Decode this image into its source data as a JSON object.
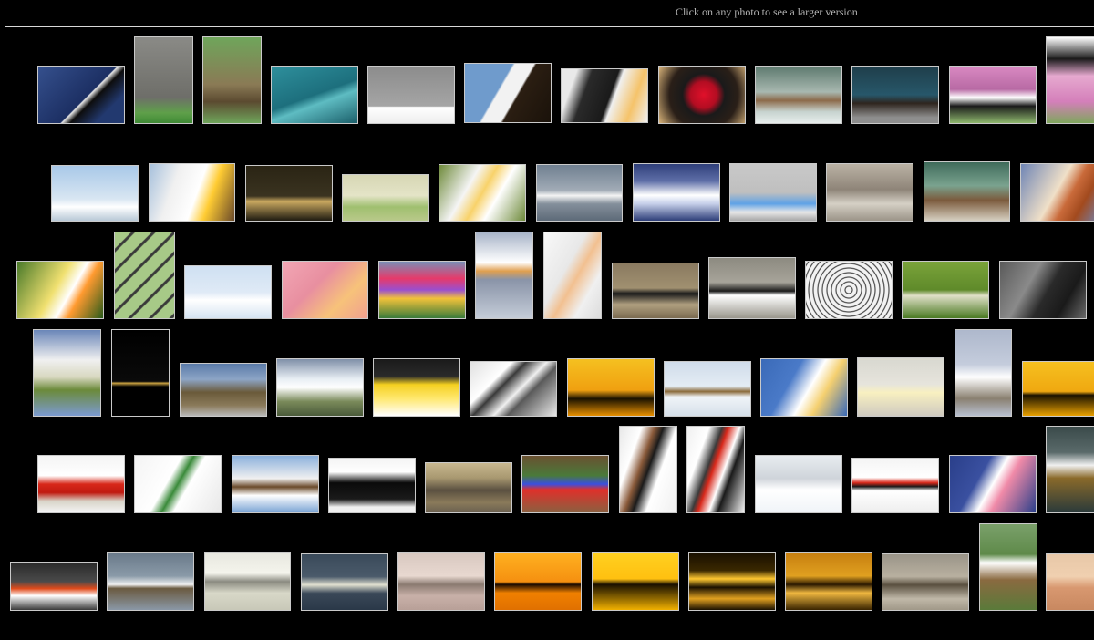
{
  "header": {
    "instruction": "Click on any photo to see a larger version"
  },
  "colors": {
    "background": "#000000",
    "text": "#b4b4b4",
    "rule": "#d8d8d8",
    "thumb_border": "#c9c9c9"
  },
  "gallery": {
    "rows": [
      [
        {
          "name": "blue-sea-bird-photo",
          "bg": "linear-gradient(135deg,#35508d 0%,#1c2f63 55%,#e8e8e8 56%,#0d0d0d 62%,#22396f 80%)"
        },
        {
          "name": "elephants-photo",
          "bg": "linear-gradient(180deg,#8a8a86 0%,#6e6e69 70%,#5fa04a 88%,#3f8a35 100%)"
        },
        {
          "name": "crane-nest-photo",
          "bg": "linear-gradient(180deg,#6fa55b 0%,#8a7a55 55%,#5b4a30 75%,#6fa55b 100%)"
        },
        {
          "name": "eagle-over-water-photo",
          "bg": "linear-gradient(160deg,#2e8f9c 0%,#1d6f7d 50%,#5ebcc2 62%,#1b5f6a 100%)"
        },
        {
          "name": "eagle-snow-photo",
          "bg": "linear-gradient(180deg,#8c8c8c 0%,#a5a5a5 70%,#ffffff 72%,#eeeeee 100%)"
        },
        {
          "name": "bald-eagle-head-photo",
          "bg": "linear-gradient(120deg,#6f9bcc 0%,#6f9bcc 40%,#f2f2f2 42%,#f2f2f2 58%,#2b1e12 60%,#1a120a 100%)"
        },
        {
          "name": "penguin-closeup-photo",
          "bg": "linear-gradient(110deg,#e9e9e9 0%,#e9e9e9 15%,#2a2a2a 30%,#1a1a1a 55%,#f0f0f0 60%,#f5c36a 80%,#f0f0f0 100%)"
        },
        {
          "name": "frigatebird-photo",
          "bg": "radial-gradient(circle at 52% 50%,#e0102a 0%,#b30d22 25%,#1a1a1a 40%,#2a1f18 65%,#d9b47a 100%)"
        },
        {
          "name": "bear-in-river-photo",
          "bg": "linear-gradient(180deg,#5e7a6f 0%,#a8b8b0 45%,#8c6a4a 60%,#c7d3cf 80%,#e7eeec 100%)"
        },
        {
          "name": "bear-walking-photo",
          "bg": "linear-gradient(180deg,#1f3e4a 0%,#27576a 50%,#2e251e 65%,#8e8e8e 90%)"
        },
        {
          "name": "puffin-photo",
          "bg": "linear-gradient(180deg,#d989c2 0%,#b86aa4 40%,#ffffff 55%,#1a1a1a 70%,#8fb86e 100%)"
        },
        {
          "name": "puffin-flowers-photo",
          "bg": "linear-gradient(180deg,#ffffff 0%,#1a1a1a 25%,#e6a9cf 45%,#d47fba 75%,#7fa65d 100%)"
        }
      ],
      [
        {
          "name": "eagle-in-sky-photo",
          "bg": "linear-gradient(180deg,#a8c8e8 0%,#d8e6f2 60%,#ffffff 75%,#b8c8d6 100%)"
        },
        {
          "name": "bald-eagle-screaming-photo",
          "bg": "linear-gradient(110deg,#a6c0dc 0%,#f0f0f0 30%,#ffffff 55%,#ffcc33 70%,#6a4a2a 100%)"
        },
        {
          "name": "eagle-splash-photo",
          "bg": "linear-gradient(180deg,#2a2414 0%,#3a3320 55%,#c9a860 65%,#1e1a10 100%)"
        },
        {
          "name": "geese-flock-photo",
          "bg": "linear-gradient(180deg,#d6d6b4 0%,#e4e4c7 45%,#9fbf6f 70%,#b9c98a 100%)"
        },
        {
          "name": "albatross-pair-photo",
          "bg": "linear-gradient(120deg,#6e8a3a 0%,#f5f5f5 35%,#f8d26a 50%,#ffffff 65%,#6e8a3a 100%)"
        },
        {
          "name": "swan-on-lake-photo",
          "bg": "linear-gradient(180deg,#6f7f90 0%,#a1abb6 45%,#f4f4f4 55%,#848f9b 70%,#5d6a78 100%)"
        },
        {
          "name": "snow-geese-wave-photo",
          "bg": "linear-gradient(180deg,#2f3f7a 0%,#5f6fa8 30%,#ffffff 55%,#c7d0ea 70%,#2d3d78 100%)"
        },
        {
          "name": "booby-feet-egg-photo",
          "bg": "linear-gradient(180deg,#c9c9c9 0%,#bfbfbf 50%,#5fa2e6 70%,#e7e7e7 85%,#a7a7a7 100%)"
        },
        {
          "name": "bird-with-chicks-photo",
          "bg": "linear-gradient(180deg,#bbb3a5 0%,#8e8478 45%,#d5d0c5 70%,#9b9488 100%)"
        },
        {
          "name": "bear-lying-photo",
          "bg": "linear-gradient(180deg,#3f6a5a 0%,#7aa38f 40%,#7b5a3c 65%,#d6d0c2 100%)"
        },
        {
          "name": "pelican-head-photo",
          "bg": "linear-gradient(120deg,#6f85b5 0%,#f0e0c8 45%,#c96a3a 60%,#a24a1e 75%,#6f85b5 100%)"
        }
      ],
      [
        {
          "name": "egret-head-yellow-photo",
          "bg": "linear-gradient(120deg,#4a7a2a 0%,#f0e070 45%,#ffffff 60%,#ff9a30 70%,#2a5a1a 100%)"
        },
        {
          "name": "birds-grid-photo",
          "bg": "repeating-linear-gradient(135deg,#a7c987 0px,#a7c987 12px,#3a3a3a 13px,#3a3a3a 15px,#a7c987 16px)"
        },
        {
          "name": "penguins-on-ice-photo",
          "bg": "linear-gradient(180deg,#cfe0f2 0%,#dfeaf6 50%,#ffffff 65%,#d6e4f2 100%)"
        },
        {
          "name": "pink-flamingos-blur-photo",
          "bg": "linear-gradient(135deg,#f2a6b4 0%,#e88fa0 40%,#f7c27a 70%,#f0a090 100%)"
        },
        {
          "name": "tulip-field-photo",
          "bg": "linear-gradient(180deg,#7a8fb6 0%,#e63a6a 30%,#9a4fcf 50%,#f2c23a 65%,#3a7a3a 100%)"
        },
        {
          "name": "pelican-reflection-photo",
          "bg": "linear-gradient(180deg,#a8b4c8 0%,#ffffff 35%,#e0a050 45%,#8a94a8 55%,#c4ccd8 100%)"
        },
        {
          "name": "pelican-white-portrait-photo",
          "bg": "linear-gradient(120deg,#f8f8f8 0%,#e8e8e8 40%,#f2c090 55%,#f0f0f0 75%,#dcdcdc 100%)"
        },
        {
          "name": "razorbill-photo",
          "bg": "linear-gradient(180deg,#8a7a60 0%,#a09070 45%,#1a1a1a 55%,#b0a080 75%,#7a6a50 100%)"
        },
        {
          "name": "bird-wings-spread-photo",
          "bg": "linear-gradient(180deg,#8c8a80 0%,#a7a49a 40%,#1a1a1a 55%,#ffffff 62%,#9a978d 100%)"
        },
        {
          "name": "starling-flock-photo",
          "bg": "repeating-radial-gradient(circle at 50% 50%,#f2f2f2 0px,#f2f2f2 3px,#2a2a2a 4px,#f2f2f2 5px)"
        },
        {
          "name": "small-bird-branch-photo",
          "bg": "linear-gradient(180deg,#7aa33a 0%,#5f8a2a 50%,#e0e0c8 60%,#4a7a22 100%)"
        },
        {
          "name": "cormorant-bill-photo",
          "bg": "linear-gradient(120deg,#5a5a5a 0%,#8a8a8a 35%,#2a2a2a 55%,#1a1a1a 75%,#6a6a6a 100%)"
        }
      ],
      [
        {
          "name": "heron-chick-photo",
          "bg": "linear-gradient(180deg,#6a86b8 0%,#f0f0f0 35%,#d8d8c0 55%,#6b8a3a 70%,#7b9ad0 100%)"
        },
        {
          "name": "deer-outline-photo",
          "bg": "linear-gradient(180deg,#000000 0%,#0a0a0a 60%,#c8a040 62%,#000000 66%)"
        },
        {
          "name": "king-penguin-colony-photo",
          "bg": "linear-gradient(180deg,#5a7aa8 0%,#8da5c6 30%,#6a5a3a 55%,#8a7a5a 80%,#b8b8b8 100%)"
        },
        {
          "name": "snowy-mountains-photo",
          "bg": "linear-gradient(180deg,#7f8fa8 0%,#e8eef4 35%,#ffffff 50%,#7a8a5a 75%,#4a5a3a 100%)"
        },
        {
          "name": "yellow-feathers-photo",
          "bg": "linear-gradient(180deg,#1a1a1a 0%,#2a2a2a 30%,#f5d020 45%,#ffe870 70%,#ffffff 100%)"
        },
        {
          "name": "snow-terrain-photo",
          "bg": "linear-gradient(135deg,#e0e0e0 0%,#ffffff 30%,#3a3a3a 40%,#f0f0f0 55%,#5a5a5a 65%,#e8e8e8 100%)"
        },
        {
          "name": "albatross-silhouette-photo",
          "bg": "linear-gradient(180deg,#f5c020 0%,#f0a010 55%,#1a1200 70%,#e89000 100%)"
        },
        {
          "name": "bird-in-flight-photo",
          "bg": "linear-gradient(180deg,#d0dcea 0%,#e4ecf4 45%,#8a6a3a 55%,#f0f4f8 65%,#d6e0ea 100%)"
        },
        {
          "name": "albatross-head-photo",
          "bg": "linear-gradient(120deg,#3a6ab8 0%,#4a7ac8 35%,#ffffff 55%,#f5d070 70%,#3a6ab8 100%)"
        },
        {
          "name": "chick-on-sand-photo",
          "bg": "linear-gradient(180deg,#d8d8d0 0%,#e6e4dc 45%,#f8f0c0 60%,#cfcac0 100%)"
        },
        {
          "name": "egret-standing-photo",
          "bg": "linear-gradient(180deg,#aeb8cc 0%,#c4ccdc 40%,#ffffff 55%,#8a8070 80%,#b8c0d0 100%)"
        },
        {
          "name": "curlew-sunset-photo",
          "bg": "linear-gradient(180deg,#f5c020 0%,#f0a810 55%,#1a1200 62%,#e8a000 100%)"
        }
      ],
      [
        {
          "name": "cardinal-photo",
          "bg": "linear-gradient(180deg,#f4f4f4 0%,#ffffff 35%,#d8281a 50%,#c01a10 65%,#d8d4c8 80%,#f4f4f4 100%)"
        },
        {
          "name": "gannets-nesting-photo",
          "bg": "linear-gradient(120deg,#f4f4f4 0%,#ffffff 40%,#3a8a3a 50%,#ffffff 60%,#e8e8e8 100%)"
        },
        {
          "name": "osprey-photo",
          "bg": "linear-gradient(180deg,#8ab0dc 0%,#f0f0f0 40%,#6a4a2a 55%,#ffffff 70%,#7aa4d4 100%)"
        },
        {
          "name": "cypress-trees-photo",
          "bg": "linear-gradient(180deg,#f4f4f4 0%,#ffffff 25%,#0a0a0a 45%,#1a1a1a 75%,#f0f0f0 90%)"
        },
        {
          "name": "rocky-peaks-photo",
          "bg": "linear-gradient(180deg,#c8b890 0%,#a89870 30%,#5a5040 55%,#8a7a5a 80%,#6a6050 100%)"
        },
        {
          "name": "painted-bunting-photo",
          "bg": "linear-gradient(180deg,#6a5030 0%,#4a7a3a 35%,#3a50e0 50%,#e0302a 60%,#8a6040 100%)"
        },
        {
          "name": "crane-neck-photo",
          "bg": "linear-gradient(110deg,#e8e8e8 0%,#ffffff 25%,#8a5a3a 40%,#1a1a1a 50%,#ffffff 65%,#f0f0f0 100%)"
        },
        {
          "name": "cranes-crossed-photo",
          "bg": "linear-gradient(110deg,#f0f0f0 0%,#ffffff 25%,#3a3a3a 40%,#d8281a 47%,#ffffff 60%,#1a1a1a 70%,#f0f0f0 100%)"
        },
        {
          "name": "snowy-field-photo",
          "bg": "linear-gradient(180deg,#e8ecf0 0%,#cfd4da 40%,#ffffff 60%,#f0f4f8 100%)"
        },
        {
          "name": "crane-dancing-photo",
          "bg": "linear-gradient(180deg,#f4f4f4 0%,#ffffff 35%,#d8281a 45%,#1a1a1a 52%,#ffffff 60%,#eeeeee 100%)"
        },
        {
          "name": "egret-pink-bill-photo",
          "bg": "linear-gradient(120deg,#2a3f8a 0%,#3a50a0 35%,#ffffff 50%,#f08aa8 62%,#2a3f8a 100%)"
        },
        {
          "name": "grebe-photo",
          "bg": "linear-gradient(180deg,#3a4a4a 0%,#5a6a6a 30%,#f0f0f0 45%,#8a6a2a 60%,#2a3a3a 100%)"
        }
      ],
      [
        {
          "name": "lava-ocean-photo",
          "bg": "linear-gradient(180deg,#2a2a2a 0%,#4a4a4a 40%,#e04a1a 55%,#ffffff 70%,#3a3a3a 100%)"
        },
        {
          "name": "shorebird-water-photo",
          "bg": "linear-gradient(180deg,#6a7a8a 0%,#8a9aa8 40%,#f0f0f0 55%,#6a5a40 62%,#8a98a6 100%)"
        },
        {
          "name": "sandhill-crane-grass-photo",
          "bg": "linear-gradient(180deg,#e8e8e0 0%,#f4f4ec 35%,#8a8a80 50%,#d8d8c8 70%,#c8c8b8 100%)"
        },
        {
          "name": "gull-flight-dusk-photo",
          "bg": "linear-gradient(180deg,#3a4a5a 0%,#4a5a6a 40%,#e0e0d0 55%,#3a4858 70%,#2a3848 100%)"
        },
        {
          "name": "cranes-flying-pink-photo",
          "bg": "linear-gradient(180deg,#d8c8c0 0%,#e8d8d0 40%,#8a7a70 55%,#c8b0a8 75%,#b8a098 100%)"
        },
        {
          "name": "cranes-orange-sky-photo",
          "bg": "linear-gradient(180deg,#ffb020 0%,#f59010 50%,#1a0a00 55%,#f08000 70%,#e07000 100%)"
        },
        {
          "name": "heron-golden-photo",
          "bg": "linear-gradient(180deg,#ffd020 0%,#ffc010 45%,#1a1000 55%,#f0b000 100%)"
        },
        {
          "name": "cranes-gold-water-photo",
          "bg": "linear-gradient(180deg,#1a1000 0%,#3a2800 30%,#ffc830 45%,#1a1000 60%,#e0a020 80%,#1a1000 100%)"
        },
        {
          "name": "marsh-sunrise-photo",
          "bg": "linear-gradient(180deg,#c88010 0%,#e0a020 40%,#2a1800 55%,#f0b840 70%,#3a2400 100%)"
        },
        {
          "name": "cranes-group-photo",
          "bg": "linear-gradient(180deg,#9a9488 0%,#b8b0a0 40%,#5a5040 55%,#c0b8a8 80%,#a09888 100%)"
        },
        {
          "name": "crane-on-nest-photo",
          "bg": "linear-gradient(180deg,#7aa06a 0%,#5f8a4a 35%,#ffffff 45%,#8a6a40 65%,#5a7a3a 100%)"
        },
        {
          "name": "flamingos-haze-photo",
          "bg": "linear-gradient(180deg,#e8c8a8 0%,#f0d0b0 40%,#d89870 60%,#c88860 100%)"
        }
      ]
    ]
  }
}
